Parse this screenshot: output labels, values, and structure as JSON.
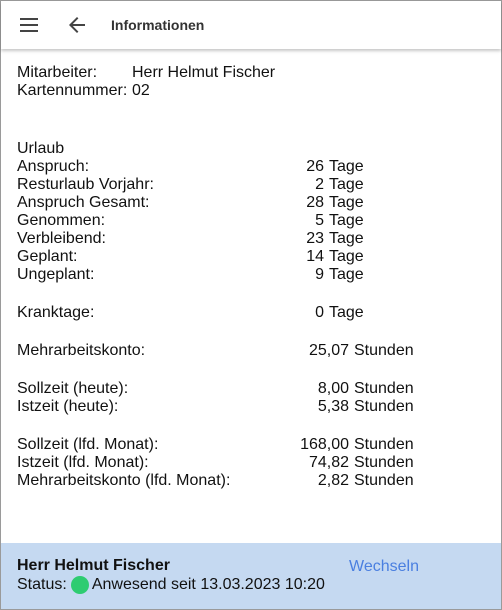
{
  "header": {
    "title": "Informationen",
    "menu_icon": "menu-icon",
    "back_icon": "arrow-left-icon"
  },
  "employee": {
    "label": "Mitarbeiter:",
    "value": "Herr Helmut Fischer",
    "card_label": "Kartennummer:",
    "card_value": "02"
  },
  "vacation": {
    "heading": "Urlaub",
    "rows": [
      {
        "label": "Anspruch:",
        "value": "26",
        "unit": "Tage"
      },
      {
        "label": "Resturlaub Vorjahr:",
        "value": "2",
        "unit": "Tage"
      },
      {
        "label": "Anspruch Gesamt:",
        "value": "28",
        "unit": "Tage"
      },
      {
        "label": "Genommen:",
        "value": "5",
        "unit": "Tage"
      },
      {
        "label": "Verbleibend:",
        "value": "23",
        "unit": "Tage"
      },
      {
        "label": "Geplant:",
        "value": "14",
        "unit": "Tage"
      },
      {
        "label": "Ungeplant:",
        "value": "9",
        "unit": "Tage"
      }
    ]
  },
  "sick": {
    "label": "Krank­tage:",
    "value": "0",
    "unit": "Tage"
  },
  "overtime": {
    "label": "Mehrarbeitskonto:",
    "value": "25,07",
    "unit": "Stunden"
  },
  "today": [
    {
      "label": "Sollzeit (heute):",
      "value": "8,00",
      "unit": "Stunden"
    },
    {
      "label": "Istzeit (heute):",
      "value": "5,38",
      "unit": "Stunden"
    }
  ],
  "month": [
    {
      "label": "Sollzeit (lfd. Monat):",
      "value": "168,00",
      "unit": "Stunden"
    },
    {
      "label": "Istzeit (lfd. Monat):",
      "value": "74,82",
      "unit": "Stunden"
    },
    {
      "label": "Mehrarbeitskonto (lfd. Monat):",
      "value": "2,82",
      "unit": "Stunden"
    }
  ],
  "footer": {
    "name": "Herr Helmut Fischer",
    "status_label": "Status:",
    "status_text": "Anwesend seit 13.03.2023 10:20",
    "status_color": "#2ecc71",
    "switch_label": "Wechseln"
  },
  "colors": {
    "footer_bg": "#c5d9f1",
    "link": "#4a7fe0"
  }
}
